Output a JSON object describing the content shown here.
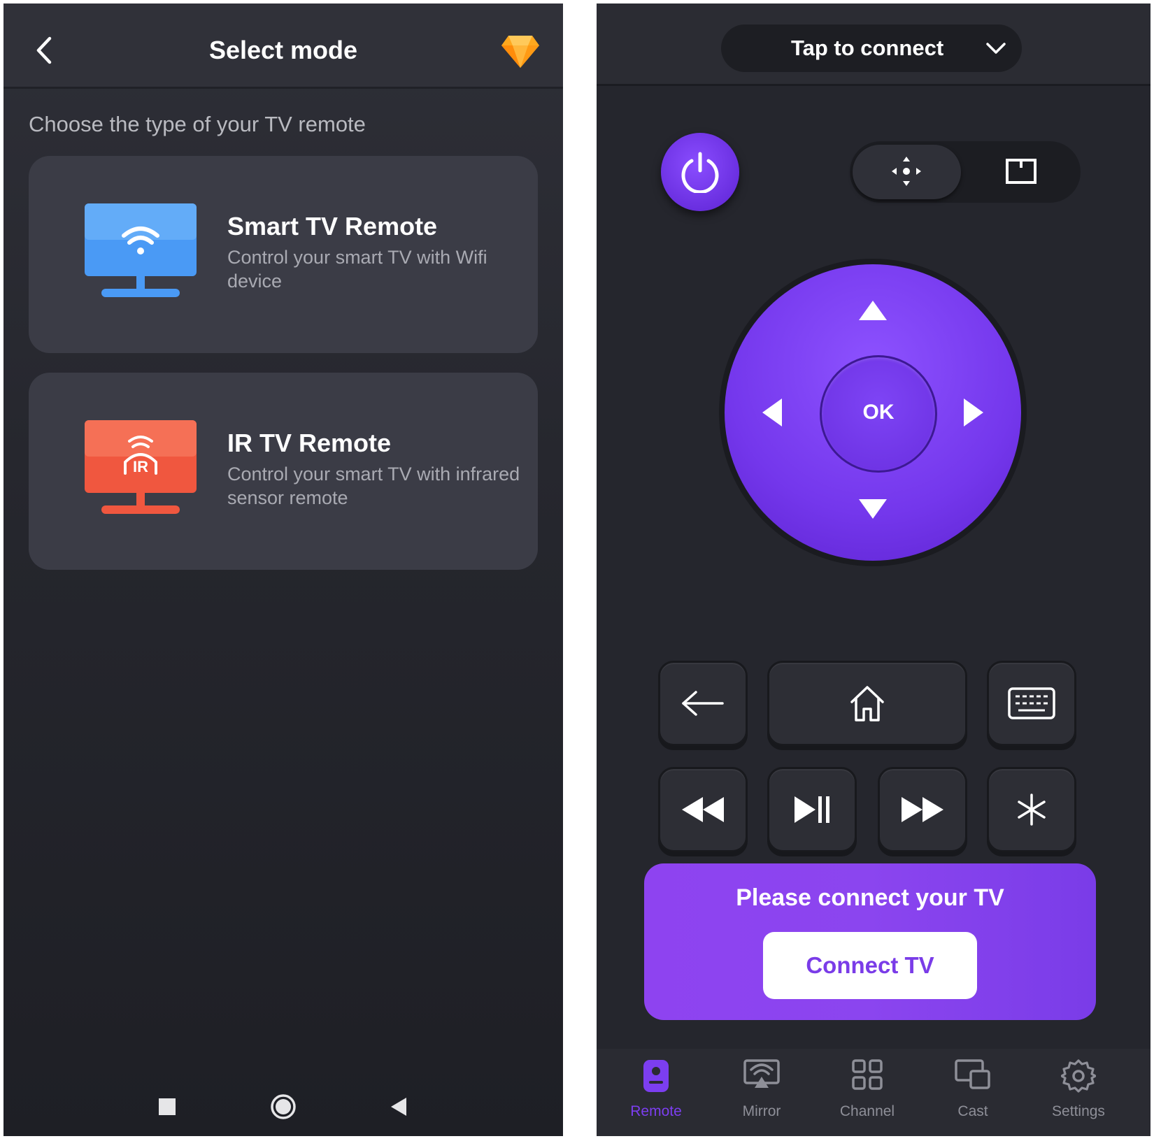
{
  "left": {
    "header": {
      "title": "Select mode"
    },
    "subtitle": "Choose the type of your TV remote",
    "cards": [
      {
        "title": "Smart TV Remote",
        "description": "Control your smart TV with Wifi device"
      },
      {
        "title": "IR TV Remote",
        "description": "Control your smart TV with infrared sensor remote",
        "badge": "IR"
      }
    ]
  },
  "right": {
    "connect_pill": {
      "label": "Tap to connect"
    },
    "dpad": {
      "center_label": "OK"
    },
    "banner": {
      "message": "Please connect your TV",
      "button": "Connect TV"
    },
    "tabs": [
      {
        "label": "Remote",
        "icon": "remote-icon",
        "active": true
      },
      {
        "label": "Mirror",
        "icon": "mirror-icon",
        "active": false
      },
      {
        "label": "Channel",
        "icon": "channel-icon",
        "active": false
      },
      {
        "label": "Cast",
        "icon": "cast-icon",
        "active": false
      },
      {
        "label": "Settings",
        "icon": "settings-icon",
        "active": false
      }
    ]
  },
  "colors": {
    "accent": "#7c3ef0",
    "smart_tv": "#4a9af5",
    "ir_tv": "#f0573f",
    "premium": "#ffa81e"
  }
}
